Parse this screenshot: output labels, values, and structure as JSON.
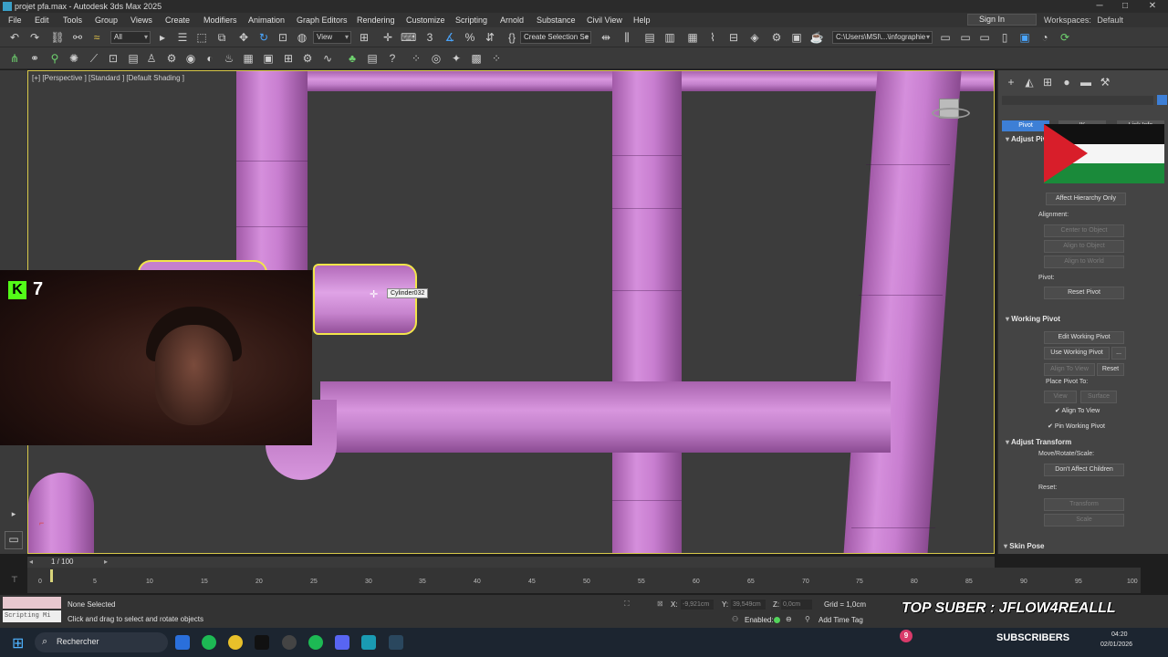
{
  "window": {
    "title": "projet pfa.max - Autodesk 3ds Max 2025"
  },
  "menu": [
    "File",
    "Edit",
    "Tools",
    "Group",
    "Views",
    "Create",
    "Modifiers",
    "Animation",
    "Graph Editors",
    "Rendering",
    "Customize",
    "Scripting",
    "Arnold",
    "Substance",
    "Civil View",
    "Help"
  ],
  "account": {
    "signin_label": "Sign In",
    "workspaces_label": "Workspaces:",
    "workspace_value": "Default"
  },
  "toolbar": {
    "filter_value": "All",
    "view_value": "View",
    "selection_set_placeholder": "Create Selection Se",
    "path_value": "C:\\Users\\MSI\\...\\infographie"
  },
  "viewport": {
    "label": "[+] [Perspective ] [Standard ] [Default Shading ]",
    "tooltip": "Cylinder032"
  },
  "webcam": {
    "kick_logo": "K",
    "viewer_count": "7"
  },
  "cmdpanel": {
    "tabs": [
      "Pivot",
      "IK",
      "Link Info"
    ],
    "adjust_pivot_title": "Adjust Pivot",
    "affect_hierarchy_only": "Affect Hierarchy Only",
    "alignment_label": "Alignment:",
    "center_to_object": "Center to Object",
    "align_to_object": "Align to Object",
    "align_to_world": "Align to World",
    "pivot_label": "Pivot:",
    "reset_pivot": "Reset Pivot",
    "working_pivot_title": "Working Pivot",
    "edit_working_pivot": "Edit Working Pivot",
    "use_working_pivot": "Use Working Pivot",
    "ellipsis": "...",
    "align_to_view_btn": "Align To View",
    "reset": "Reset",
    "place_pivot_to": "Place Pivot To:",
    "view": "View",
    "surface": "Surface",
    "align_to_view_check": "Align To View",
    "pin_working_pivot": "Pin Working Pivot",
    "adjust_transform_title": "Adjust Transform",
    "move_rotate_scale": "Move/Rotate/Scale:",
    "dont_affect_children": "Don't Affect Children",
    "reset_label": "Reset:",
    "transform": "Transform",
    "scale": "Scale",
    "skin_pose_title": "Skin Pose"
  },
  "timeline": {
    "frame_indicator": "1 / 100",
    "ticks": [
      "0",
      "5",
      "10",
      "15",
      "20",
      "25",
      "30",
      "35",
      "40",
      "45",
      "50",
      "55",
      "60",
      "65",
      "70",
      "75",
      "80",
      "85",
      "90",
      "95",
      "100"
    ]
  },
  "status": {
    "script_listener": "Scripting Mi",
    "selection": "None Selected",
    "prompt": "Click and drag to select and rotate objects",
    "x_label": "X:",
    "x_value": "-9,921cm",
    "y_label": "Y:",
    "y_value": "39,549cm",
    "z_label": "Z:",
    "z_value": "0,0cm",
    "grid": "Grid = 1,0cm",
    "enabled_label": "Enabled:",
    "add_time_tag": "Add Time Tag"
  },
  "overlay": {
    "top_suber": "TOP SUBER : JFLOW4REALLL",
    "subscriber_count": "9",
    "subscribers_label": "SUBSCRIBERS"
  },
  "taskbar": {
    "search_placeholder": "Rechercher",
    "time": "04:20",
    "date": "02/01/2026"
  },
  "colors": {
    "pipe": "#c87ed0",
    "selection": "#f2e54a",
    "accent": "#3d7fd6",
    "kick_green": "#53fc18"
  }
}
